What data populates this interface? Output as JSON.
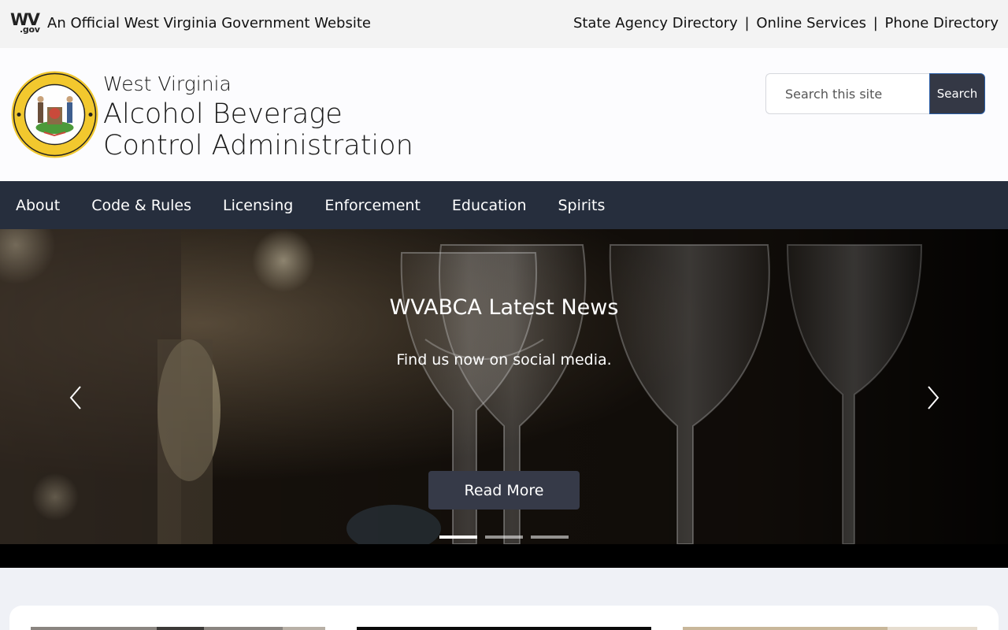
{
  "gov_bar": {
    "logo_text": "WV",
    "logo_sub": ".gov",
    "official_text": "An Official West Virginia Government Website",
    "links": [
      {
        "label": "State Agency Directory"
      },
      {
        "label": "Online Services"
      },
      {
        "label": "Phone Directory"
      }
    ],
    "separator": "|"
  },
  "header": {
    "seal_icon": "state-seal-icon",
    "name_line1": "West Virginia",
    "name_line2": "Alcohol Beverage",
    "name_line3": "Control Administration",
    "search": {
      "placeholder": "Search this site",
      "value": "",
      "button_label": "Search"
    }
  },
  "nav": {
    "items": [
      {
        "label": "About"
      },
      {
        "label": "Code & Rules"
      },
      {
        "label": "Licensing"
      },
      {
        "label": "Enforcement"
      },
      {
        "label": "Education"
      },
      {
        "label": "Spirits"
      }
    ]
  },
  "hero": {
    "title": "WVABCA Latest News",
    "subtitle": "Find us now on social media.",
    "button_label": "Read More",
    "prev_icon": "chevron-left-icon",
    "next_icon": "chevron-right-icon",
    "slide_count": 3,
    "active_slide": 1
  },
  "colors": {
    "nav_bg": "#262e3d",
    "button_bg": "#363a48",
    "gov_bar_bg": "#f3f3f3",
    "page_bg": "#eff1f6"
  }
}
